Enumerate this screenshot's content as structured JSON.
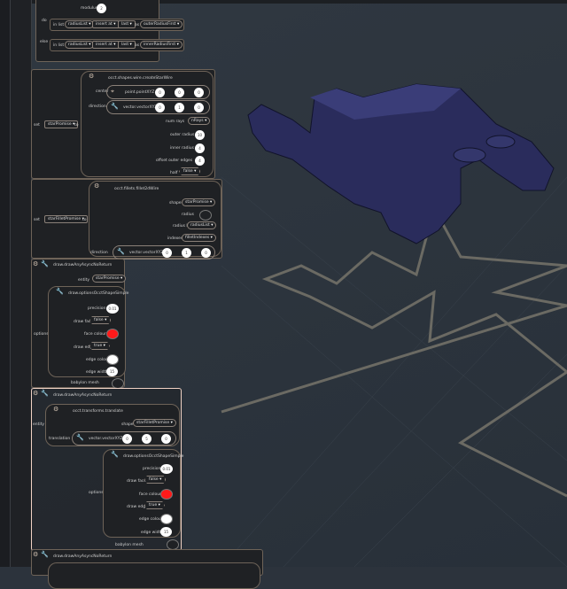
{
  "top_block": {
    "modulus_label": "modulus",
    "modulus_value": "2",
    "do_label": "do",
    "else_label": "else",
    "do_row": {
      "in_list": "in list",
      "list": "radiusList",
      "mode": "insert at",
      "where": "last",
      "as": "as",
      "value": "outerRadiusFirst"
    },
    "else_row": {
      "in_list": "in list",
      "list": "radiusList",
      "mode": "insert at",
      "where": "last",
      "as": "as",
      "value": "innerRadiusFirst"
    }
  },
  "set_star": {
    "set": "set",
    "var": "starPromise",
    "to": "to",
    "fn": "occt.shapes.wire.createStarWire",
    "center_label": "center",
    "center_fn": "point.pointXYZ",
    "center": {
      "x": "0",
      "y": "0",
      "z": "0"
    },
    "direction_label": "direction",
    "direction_fn": "vector.vectorXYZ",
    "direction": {
      "x": "0",
      "y": "1",
      "z": "0"
    },
    "num_rays_label": "num rays",
    "num_rays": "nRays",
    "outer_radius_label": "outer radius",
    "outer_radius": "10",
    "inner_radius_label": "inner radius",
    "inner_radius": "4",
    "offset_label": "offset outer edges",
    "offset": "4",
    "half_label": "half",
    "half": "false"
  },
  "set_fillet": {
    "set": "set",
    "var": "starFilletPromise",
    "to": "to",
    "fn": "occt.fillets.fillet2dWire",
    "shape_label": "shape",
    "shape": "starPromise",
    "radius_label": "radius",
    "radius_list_label": "radius list",
    "radius_list": "radiusList",
    "indexes_label": "indexes",
    "indexes": "filletIndexes",
    "direction_label": "direction",
    "direction_fn": "vector.vectorXYZ",
    "direction": {
      "x": "0",
      "y": "1",
      "z": "0"
    }
  },
  "draw1": {
    "fn": "draw.drawAnyAsyncNoReturn",
    "entity_label": "entity",
    "entity": "starPromise",
    "options_label": "options",
    "opt_fn": "draw.optionsOcctShapeSimple",
    "precision_label": "precision",
    "precision": "0.01",
    "faces_label": "draw faces",
    "faces": "false",
    "face_colour_label": "face colour",
    "edges_label": "draw edges",
    "edges": "true",
    "edge_colour_label": "edge colour",
    "edge_width_label": "edge width",
    "edge_width": "15",
    "mesh_label": "babylon mesh"
  },
  "draw2": {
    "fn": "draw.drawAnyAsyncNoReturn",
    "entity_label": "entity",
    "translate_fn": "occt.transforms.translate",
    "shape_label": "shape",
    "shape": "starFilletPromise",
    "translation_label": "translation",
    "translation_fn": "vector.vectorXYZ",
    "translation": {
      "x": "0",
      "y": "5",
      "z": "0"
    },
    "options_label": "options",
    "opt_fn": "draw.optionsOcctShapeSimple",
    "precision_label": "precision",
    "precision": "0.01",
    "faces_label": "draw faces",
    "faces": "false",
    "face_colour_label": "face colour",
    "edges_label": "draw edges",
    "edges": "true",
    "edge_colour_label": "edge colour",
    "edge_width_label": "edge width",
    "edge_width": "15",
    "mesh_label": "babylon mesh"
  },
  "draw3": {
    "fn": "draw.drawAnyAsyncNoReturn"
  },
  "colors": {
    "face": "#ff1a1a",
    "edge": "#ffffff",
    "shape": "#2a2c5c"
  }
}
